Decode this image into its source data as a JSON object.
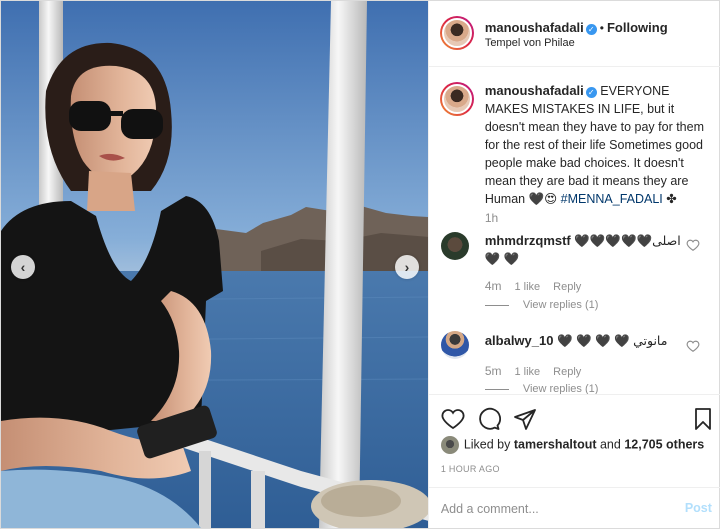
{
  "post": {
    "author": {
      "username": "manoushafadali",
      "verified_badge": "✓",
      "follow_state": "Following",
      "separator": "•",
      "location": "Tempel von Philae"
    },
    "photo": {
      "prev_arrow": "‹",
      "next_arrow": "›"
    },
    "caption": {
      "username": "manoushafadali",
      "text": "EVERYONE MAKES MISTAKES IN LIFE, but it doesn't mean they have to pay for them for the rest of their life Sometimes good people make bad choices. It doesn't mean they are bad it means they are Human 🖤😍 ",
      "hashtag": "#MENNA_FADALI",
      "suffix": " ✤",
      "time": "1h"
    },
    "comments": [
      {
        "username": "mhmdrzqmstf",
        "text": "اصلى🖤🖤🖤🖤🖤🖤 🖤",
        "time": "4m",
        "likes": "1 like",
        "reply_label": "Reply",
        "view_replies": "View replies (1)"
      },
      {
        "username": "albalwy_10",
        "text": "مانوتي 🖤 🖤 🖤 🖤",
        "time": "5m",
        "likes": "1 like",
        "reply_label": "Reply",
        "view_replies": "View replies (1)"
      }
    ],
    "likes": {
      "prefix": "Liked by ",
      "first_user": "tamershaltout",
      "middle": " and ",
      "others": "12,705 others"
    },
    "posted_time": "1 HOUR AGO",
    "add_comment": {
      "placeholder": "Add a comment...",
      "post_label": "Post"
    },
    "icons": [
      "heart-icon",
      "comment-icon",
      "share-icon",
      "bookmark-icon"
    ],
    "colors": {
      "link": "#00376b",
      "verified": "#3897f0",
      "muted": "#8e8e8e",
      "post_disabled": "#b2dffc"
    }
  }
}
